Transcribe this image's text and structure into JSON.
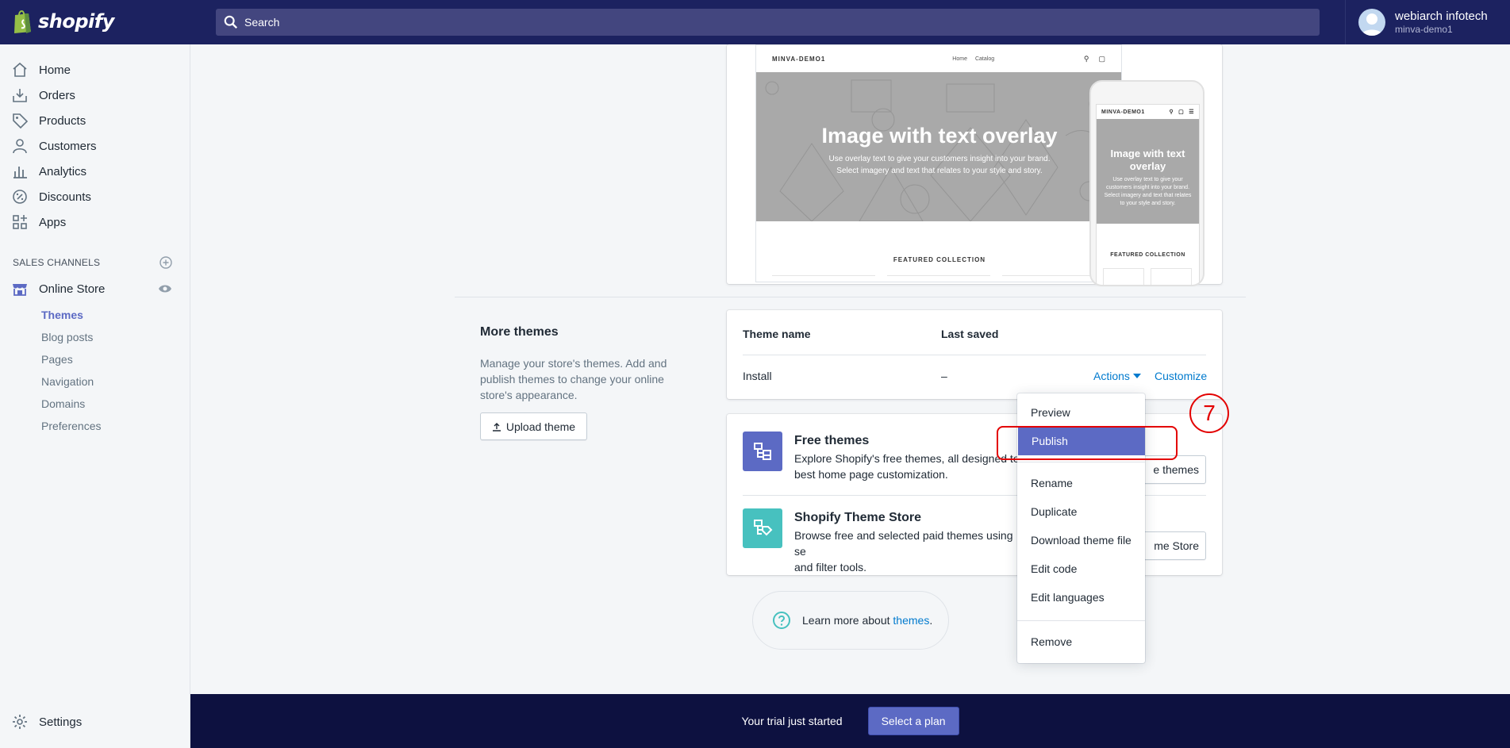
{
  "topbar": {
    "logo_text": "shopify",
    "search_placeholder": "Search",
    "account_name": "webiarch infotech",
    "store_name": "minva-demo1"
  },
  "sidebar": {
    "items": [
      {
        "label": "Home",
        "icon": "home-icon"
      },
      {
        "label": "Orders",
        "icon": "orders-icon"
      },
      {
        "label": "Products",
        "icon": "tag-icon"
      },
      {
        "label": "Customers",
        "icon": "person-icon"
      },
      {
        "label": "Analytics",
        "icon": "bar-chart-icon"
      },
      {
        "label": "Discounts",
        "icon": "discount-icon"
      },
      {
        "label": "Apps",
        "icon": "apps-icon"
      }
    ],
    "sales_channels_heading": "SALES CHANNELS",
    "online_store_label": "Online Store",
    "sub_items": [
      "Themes",
      "Blog posts",
      "Pages",
      "Navigation",
      "Domains",
      "Preferences"
    ],
    "active_sub_item": "Themes",
    "settings_label": "Settings"
  },
  "preview": {
    "desktop": {
      "brand": "MINVA-DEMO1",
      "links": [
        "Home",
        "Catalog"
      ],
      "hero_title": "Image with text overlay",
      "hero_line1": "Use overlay text to give your customers insight into your brand.",
      "hero_line2": "Select imagery and text that relates to your style and story.",
      "featured": "FEATURED COLLECTION"
    },
    "mobile": {
      "brand": "MINVA-DEMO1",
      "hero_title": "Image with text overlay",
      "hero_text": "Use overlay text to give your customers insight into your brand. Select imagery and text that relates to your style and story.",
      "featured": "FEATURED COLLECTION"
    }
  },
  "more_themes": {
    "title": "More themes",
    "description": "Manage your store's themes. Add and publish themes to change your online store's appearance.",
    "upload_label": "Upload theme",
    "col_name": "Theme name",
    "col_saved": "Last saved",
    "row": {
      "name": "Install",
      "saved": "–",
      "actions_label": "Actions",
      "customize_label": "Customize"
    }
  },
  "free_themes": {
    "title": "Free themes",
    "description_visible": "Explore Shopify's free themes, all designed to",
    "description_line2": "best home page customization.",
    "button_visible": "e themes"
  },
  "theme_store": {
    "title": "Shopify Theme Store",
    "description_visible": "Browse free and selected paid themes using se",
    "description_line2": "and filter tools.",
    "button_visible": "me Store"
  },
  "learn_more": {
    "text": "Learn more about",
    "link": "themes",
    "period": "."
  },
  "actions_menu": {
    "items": [
      "Preview",
      "Publish",
      "Rename",
      "Duplicate",
      "Download theme file",
      "Edit code",
      "Edit languages",
      "Remove"
    ],
    "selected": "Publish"
  },
  "annotation": {
    "step_number": "7",
    "color": "#e30000"
  },
  "bottom_bar": {
    "text": "Your trial just started",
    "button_label": "Select a plan"
  },
  "colors": {
    "topbar": "#1c2260",
    "accent": "#5c6ac4",
    "link": "#007ace",
    "bottombar": "#0d1140",
    "teal": "#47c1bf"
  }
}
